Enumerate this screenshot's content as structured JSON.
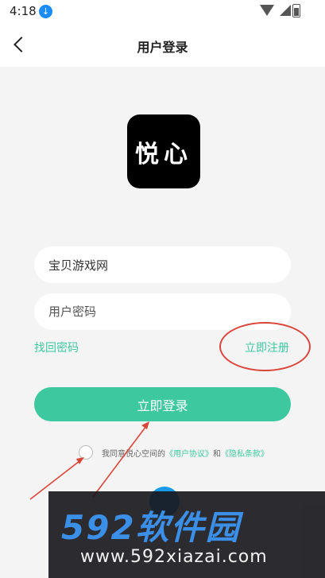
{
  "status_bar": {
    "time": "4:18"
  },
  "header": {
    "title": "用户登录"
  },
  "logo": {
    "text": "悦心"
  },
  "form": {
    "account_value": "宝贝游戏网",
    "password_placeholder": "用户密码",
    "forgot_label": "找回密码",
    "register_label": "立即注册",
    "login_label": "立即登录"
  },
  "agreement": {
    "prefix": "我同意悦心空间的",
    "user_agreement": "《用户协议》",
    "conjunction": "和",
    "privacy_policy": "《隐私条款》"
  },
  "watermark": {
    "brand": "592软件园",
    "url": "www.592xiazai.com"
  },
  "colors": {
    "accent": "#3ec8a0",
    "annotation": "#d9453a",
    "background": "#f4f4f4"
  }
}
